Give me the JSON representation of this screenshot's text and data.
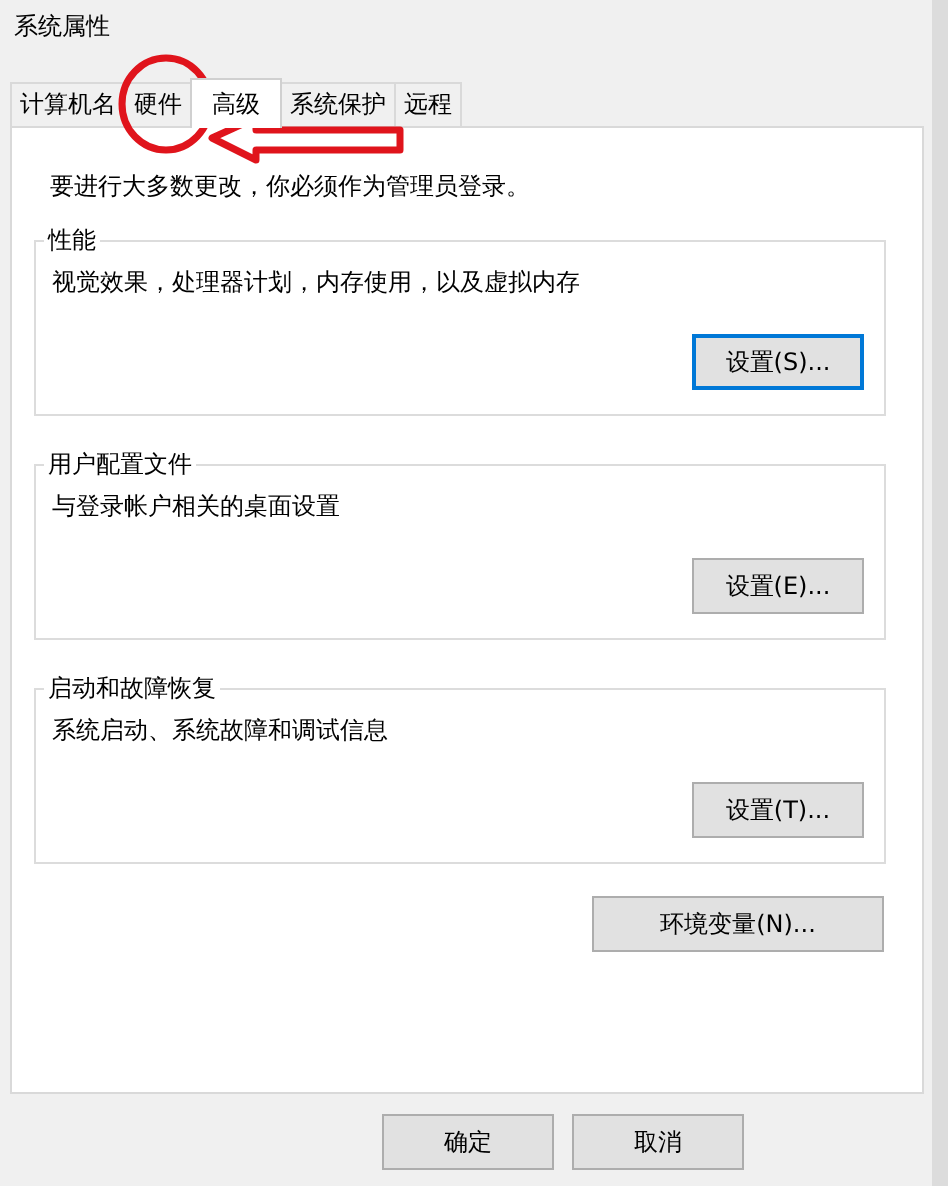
{
  "window": {
    "title": "系统属性"
  },
  "tabs": [
    {
      "label": "计算机名",
      "selected": false
    },
    {
      "label": "硬件",
      "selected": false
    },
    {
      "label": "高级",
      "selected": true
    },
    {
      "label": "系统保护",
      "selected": false
    },
    {
      "label": "远程",
      "selected": false
    }
  ],
  "notice": "要进行大多数更改，你必须作为管理员登录。",
  "groups": [
    {
      "title": "性能",
      "description": "视觉效果，处理器计划，内存使用，以及虚拟内存",
      "button": {
        "label": "设置(S)...",
        "focused": true
      }
    },
    {
      "title": "用户配置文件",
      "description": "与登录帐户相关的桌面设置",
      "button": {
        "label": "设置(E)...",
        "focused": false
      }
    },
    {
      "title": "启动和故障恢复",
      "description": "系统启动、系统故障和调试信息",
      "button": {
        "label": "设置(T)...",
        "focused": false
      }
    }
  ],
  "environment_button": "环境变量(N)...",
  "dialog_buttons": [
    "确定",
    "取消"
  ]
}
